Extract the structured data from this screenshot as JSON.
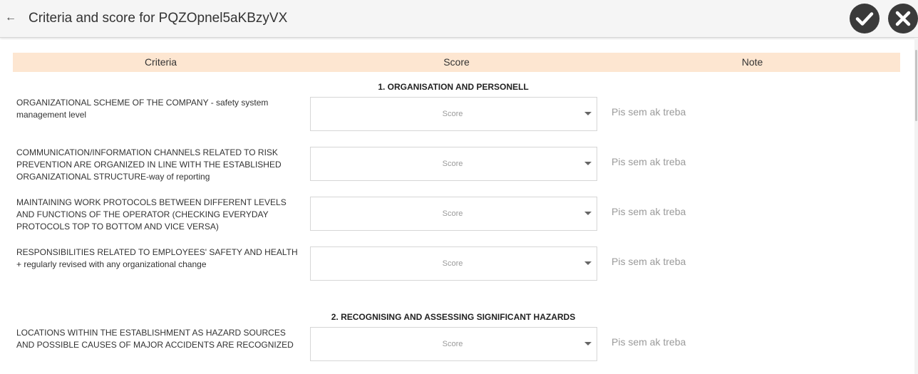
{
  "header": {
    "back_icon": "arrow-left-icon",
    "title": "Criteria and score for PQZOpnel5aKBzyVX",
    "confirm_icon": "checkmark-icon",
    "close_icon": "close-icon"
  },
  "table": {
    "columns": [
      "Criteria",
      "Score",
      "Note"
    ]
  },
  "sections": [
    {
      "title": "1. ORGANISATION AND PERSONELL",
      "items": [
        {
          "criteria": "ORGANIZATIONAL SCHEME OF THE COMPANY - safety system management level",
          "score_placeholder": "Score",
          "note_placeholder": "Pis sem ak treba"
        },
        {
          "criteria": "COMMUNICATION/INFORMATION CHANNELS RELATED TO RISK PREVENTION ARE ORGANIZED IN LINE WITH THE ESTABLISHED ORGANIZATIONAL STRUCTURE-way of reporting",
          "score_placeholder": "Score",
          "note_placeholder": "Pis sem ak treba"
        },
        {
          "criteria": "MAINTAINING WORK PROTOCOLS BETWEEN DIFFERENT LEVELS AND FUNCTIONS OF THE OPERATOR (CHECKING EVERYDAY PROTOCOLS TOP TO BOTTOM AND VICE VERSA)",
          "score_placeholder": "Score",
          "note_placeholder": "Pis sem ak treba"
        },
        {
          "criteria": "RESPONSIBILITIES RELATED TO EMPLOYEES' SAFETY AND HEALTH + regularly revised with any organizational change",
          "score_placeholder": "Score",
          "note_placeholder": "Pis sem ak treba"
        }
      ]
    },
    {
      "title": "2. RECOGNISING AND ASSESSING SIGNIFICANT HAZARDS",
      "items": [
        {
          "criteria": "LOCATIONS WITHIN THE ESTABLISHMENT AS HAZARD SOURCES AND POSSIBLE CAUSES OF MAJOR ACCIDENTS ARE RECOGNIZED",
          "score_placeholder": "Score",
          "note_placeholder": "Pis sem ak treba"
        }
      ]
    }
  ],
  "colors": {
    "header_bg": "#fde6d1",
    "button_bg": "#3a3a3a"
  }
}
